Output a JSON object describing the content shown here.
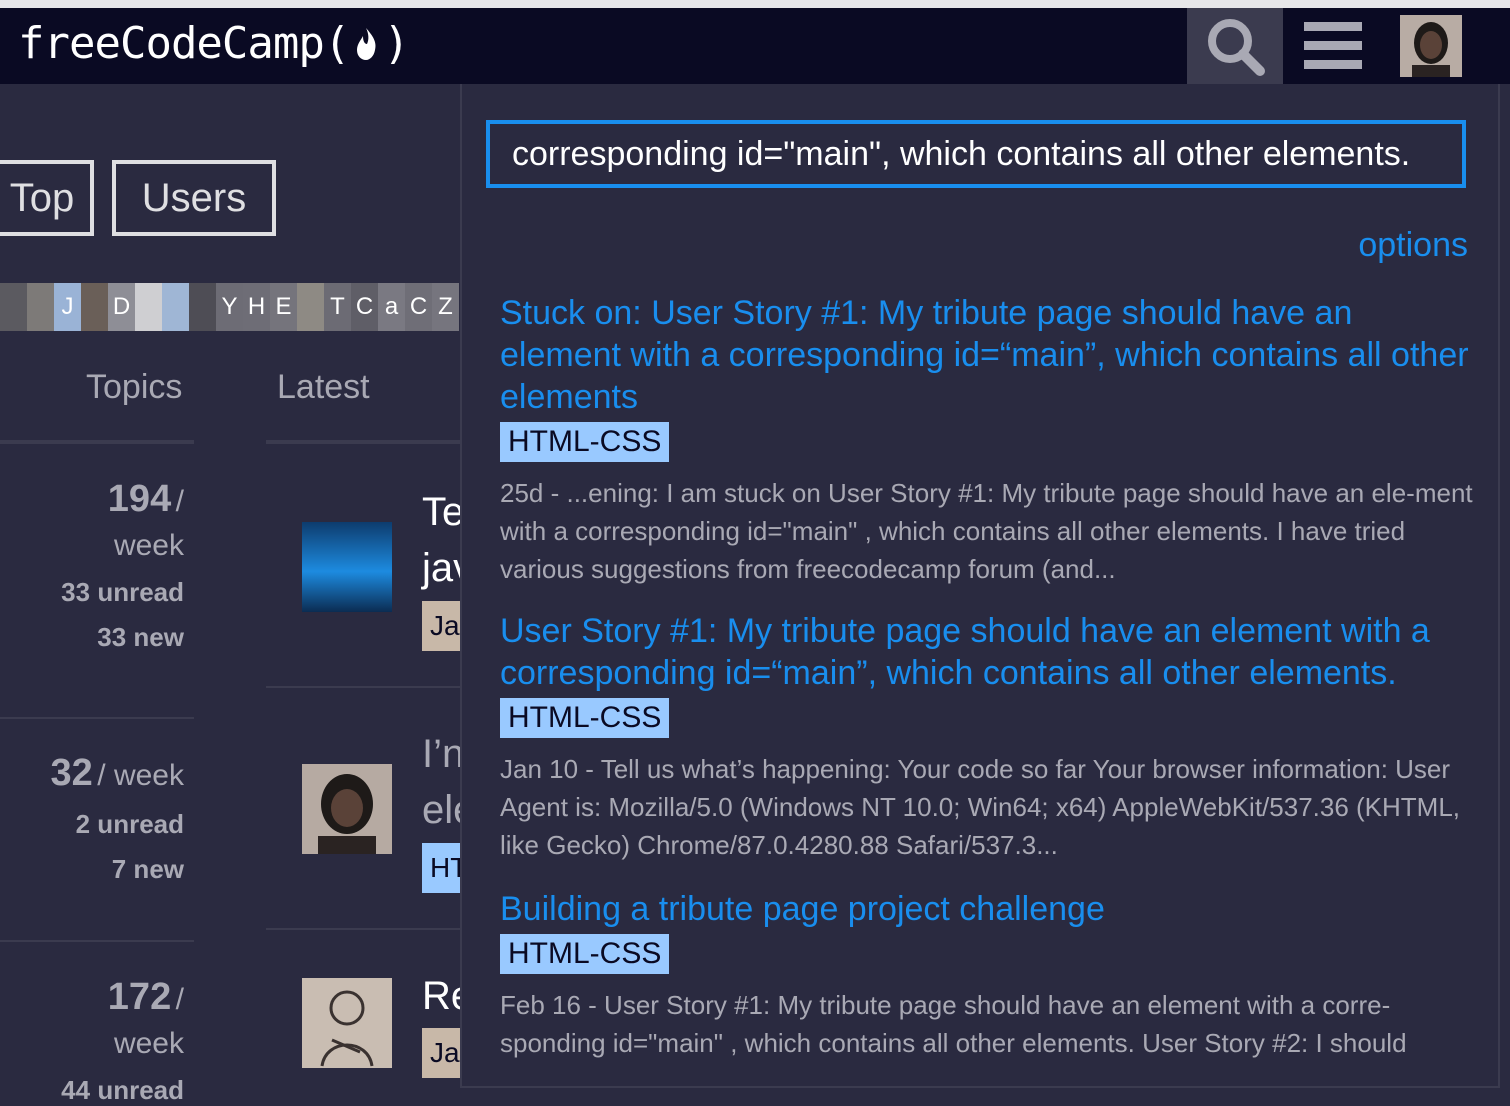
{
  "header": {
    "logo_text_left": "freeCodeCamp(",
    "logo_text_right": ")",
    "icons": [
      "search-icon",
      "hamburger-menu-icon",
      "user-avatar"
    ]
  },
  "nav": {
    "top_label": "Top",
    "users_label": "Users"
  },
  "avatar_strip": [
    "J",
    "D",
    "Y",
    "H",
    "E",
    "T",
    "C",
    "a",
    "C",
    "Z"
  ],
  "columns": {
    "topics": "Topics",
    "latest": "Latest"
  },
  "stats": [
    {
      "big": "194",
      "unit": "/",
      "unit2": "week",
      "unread": "33 unread",
      "new": "33 new"
    },
    {
      "big": "32",
      "unit": "/ week",
      "unit2": "",
      "unread": "2 unread",
      "new": "7 new"
    },
    {
      "big": "172",
      "unit": "/",
      "unit2": "week",
      "unread": "44 unread",
      "new": ""
    }
  ],
  "topic_titles": [
    {
      "line1": "Te",
      "line2": "jav",
      "tag": "Ja"
    },
    {
      "line1": "I’n",
      "line2": "ele",
      "tag": "HT"
    },
    {
      "line1": "Re",
      "line2": "",
      "tag": "Ja"
    }
  ],
  "search": {
    "query": "corresponding id=\"main\", which contains all other elements.",
    "options_label": "options",
    "results": [
      {
        "title": "Stuck on: User Story #1: My tribute page should have an element with a corresponding id=“main”, which contains all other elements",
        "tag": "HTML-CSS",
        "snippet": "25d - ...ening: I am stuck on User Story #1: My tribute page should have an ele-ment with a corresponding id=\"main\" , which contains all other elements. I have tried various suggestions from freecodecamp forum (and..."
      },
      {
        "title": "User Story #1: My tribute page should have an element with a corresponding id=“main”, which contains all other elements.",
        "tag": "HTML-CSS",
        "snippet": "Jan 10 - Tell us what’s happening: Your code so far Your browser information: User Agent is: Mozilla/5.0 (Windows NT 10.0; Win64; x64) AppleWebKit/537.36 (KHTML, like Gecko) Chrome/87.0.4280.88 Safari/537.3..."
      },
      {
        "title": "Building a tribute page project challenge",
        "tag": "HTML-CSS",
        "snippet": "Feb 16 - User Story #1: My tribute page should have an element with a corre-sponding id=\"main\" , which contains all other elements. User Story #2: I should"
      }
    ]
  },
  "colors": {
    "header_bg": "#0a0a23",
    "page_bg": "#2a2a40",
    "link_blue": "#198eee",
    "tag_bg": "#99c9ff"
  }
}
